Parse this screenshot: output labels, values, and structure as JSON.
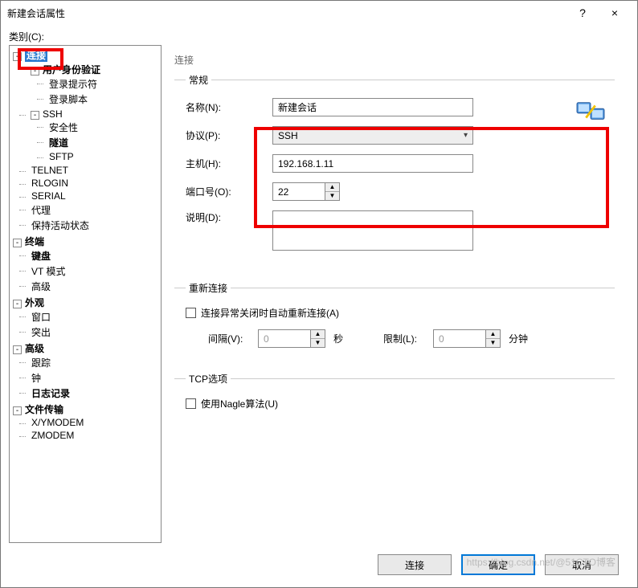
{
  "window": {
    "title": "新建会话属性",
    "help": "?",
    "close": "×"
  },
  "category_label": "类别(C):",
  "tree": {
    "connection": "连接",
    "user_auth": "用户身份验证",
    "login_prompt": "登录提示符",
    "login_script": "登录脚本",
    "ssh": "SSH",
    "security": "安全性",
    "tunnel": "隧道",
    "sftp": "SFTP",
    "telnet": "TELNET",
    "rlogin": "RLOGIN",
    "serial": "SERIAL",
    "proxy": "代理",
    "keepalive": "保持活动状态",
    "terminal": "终端",
    "keyboard": "键盘",
    "vt_mode": "VT 模式",
    "advanced_term": "高级",
    "appearance": "外观",
    "window": "窗口",
    "highlight": "突出",
    "advanced": "高级",
    "trace": "跟踪",
    "clock": "钟",
    "logging": "日志记录",
    "file_transfer": "文件传输",
    "xymodem": "X/YMODEM",
    "zmodem": "ZMODEM"
  },
  "panel": {
    "heading": "连接",
    "general": {
      "legend": "常规",
      "name_label": "名称(N):",
      "name_value": "新建会话",
      "protocol_label": "协议(P):",
      "protocol_value": "SSH",
      "host_label": "主机(H):",
      "host_value": "192.168.1.11",
      "port_label": "端口号(O):",
      "port_value": "22",
      "desc_label": "说明(D):",
      "desc_value": ""
    },
    "reconnect": {
      "legend": "重新连接",
      "auto_label": "连接异常关闭时自动重新连接(A)",
      "interval_label": "间隔(V):",
      "interval_value": "0",
      "interval_unit": "秒",
      "limit_label": "限制(L):",
      "limit_value": "0",
      "limit_unit": "分钟"
    },
    "tcp": {
      "legend": "TCP选项",
      "nagle_label": "使用Nagle算法(U)"
    }
  },
  "footer": {
    "connect": "连接",
    "ok": "确定",
    "cancel": "取消"
  },
  "watermark": "https://blog.csdn.net/@51CTO博客"
}
